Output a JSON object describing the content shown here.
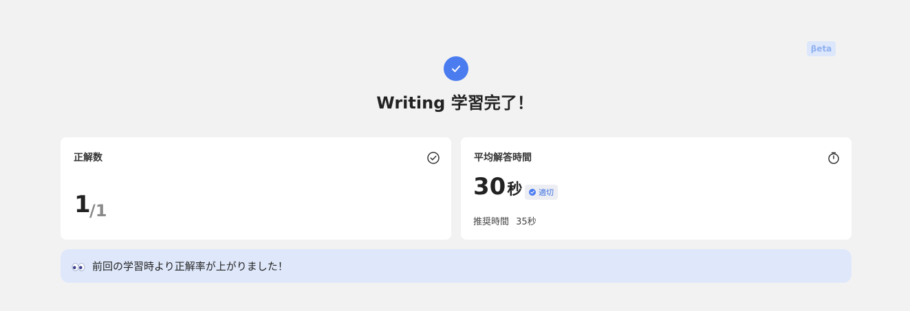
{
  "badge": {
    "label": "βeta"
  },
  "header": {
    "title": "Writing 学習完了！",
    "check_icon": "check-icon"
  },
  "correct_card": {
    "label": "正解数",
    "icon": "check-circle-icon",
    "value": "1",
    "total": "/1"
  },
  "time_card": {
    "label": "平均解答時間",
    "icon": "stopwatch-icon",
    "value": "30",
    "unit": "秒",
    "status_badge": "適切",
    "recommended_label": "推奨時間",
    "recommended_value": "35秒"
  },
  "banner": {
    "icon": "eyes-icon",
    "message": "前回の学習時より正解率が上がりました！"
  },
  "colors": {
    "accent": "#4a7cf0",
    "background": "#f2f2f2",
    "banner": "#dfe8fb"
  }
}
